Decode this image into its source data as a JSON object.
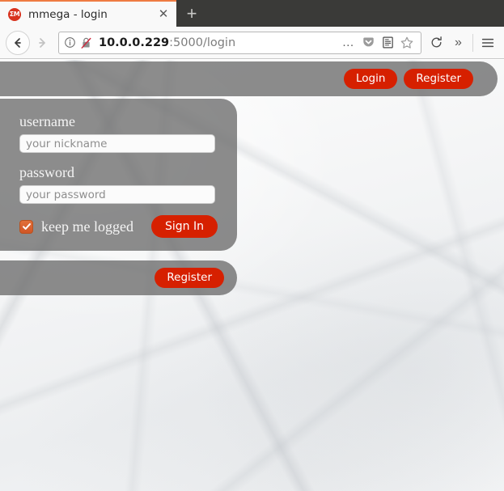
{
  "browser": {
    "tab": {
      "favicon_label": "ΣM",
      "favicon_icon": "mmega-favicon-icon",
      "title": "mmega - login",
      "close_icon": "✕"
    },
    "newtab_label": "+",
    "nav": {
      "back_icon": "back-arrow-icon",
      "forward_icon": "forward-arrow-icon",
      "reload_icon": "reload-icon",
      "overflow_icon": "»",
      "menu_icon": "hamburger-menu-icon",
      "page_actions_icon": "…",
      "pocket_icon": "pocket-icon",
      "reader_icon": "reader-view-icon",
      "bookmark_icon": "star-bookmark-icon"
    },
    "url": {
      "info_icon": "site-info-icon",
      "insecure_icon": "insecure-broken-lock-icon",
      "host": "10.0.0.229",
      "path": ":5000/login",
      "full": "10.0.0.229:5000/login"
    }
  },
  "page": {
    "header": {
      "login_label": "Login",
      "register_label": "Register"
    },
    "login_form": {
      "username_label": "username",
      "username_placeholder": "your nickname",
      "username_value": "",
      "password_label": "password",
      "password_placeholder": "your password",
      "password_value": "",
      "keep_logged_label": "keep me logged",
      "keep_logged_checked": true,
      "submit_label": "Sign In"
    },
    "register_panel": {
      "register_label": "Register"
    },
    "colors": {
      "accent_red": "#d62000",
      "panel_gray": "#6c6c6c",
      "checkbox_orange": "#d45f2b",
      "tab_accent": "#ef7b42",
      "background": "#f2f2f2"
    }
  }
}
